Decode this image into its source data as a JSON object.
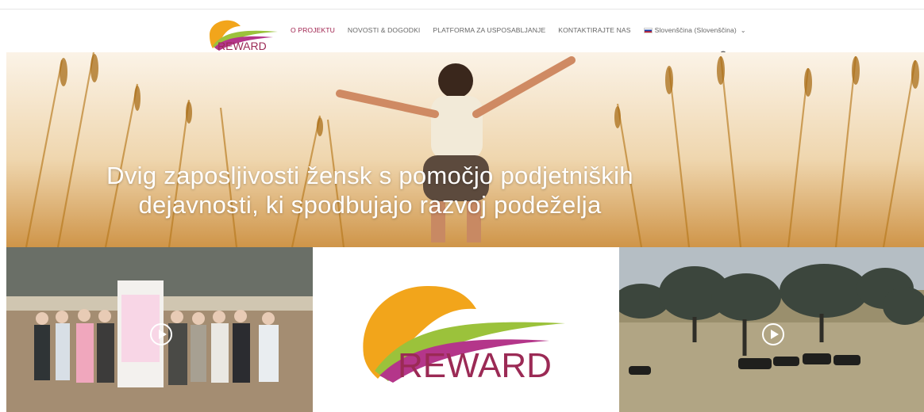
{
  "header": {
    "logo_text": "REWARD",
    "nav": [
      {
        "label": "O PROJEKTU",
        "active": true
      },
      {
        "label": "NOVOSTI & DOGODKI",
        "active": false
      },
      {
        "label": "PLATFORMA ZA USPOSABLJANJE",
        "active": false
      },
      {
        "label": "KONTAKTIRAJTE NAS",
        "active": false
      }
    ],
    "language": "Slovenščina (Slovenščina)",
    "language_flag": "slovenia-flag-icon",
    "search_icon": "search-icon"
  },
  "hero": {
    "line1": "Dvig zaposljivosti žensk s pomočjo podjetniških",
    "line2": "dejavnosti, ki spodbujajo razvoj podeželja"
  },
  "tiles": {
    "left_icon": "play-icon",
    "middle_logo_text": "REWARD",
    "right_icon": "play-icon"
  },
  "colors": {
    "accent": "#a0234f",
    "logo_orange": "#f2a51b",
    "logo_green": "#9bc23b",
    "logo_magenta": "#9b2a55"
  }
}
